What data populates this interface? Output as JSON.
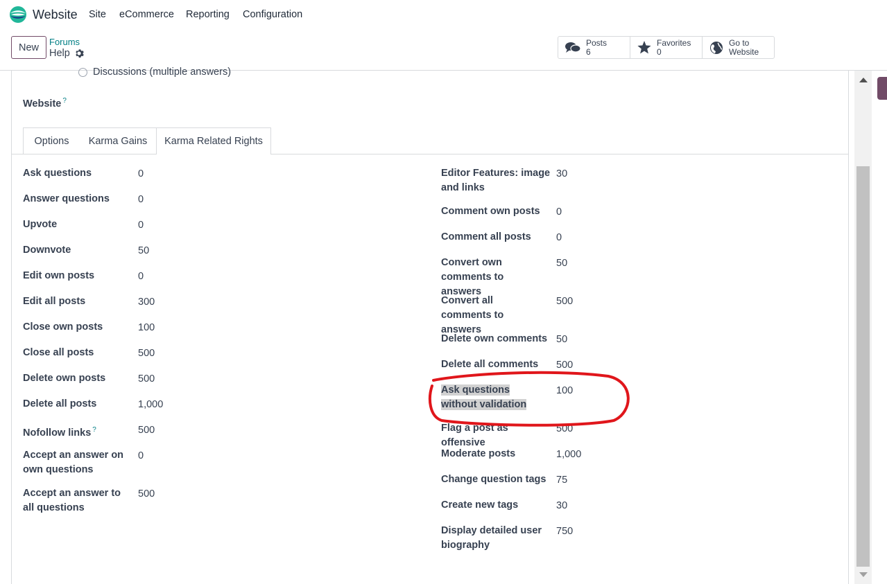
{
  "app": {
    "title": "Website",
    "menu": [
      "Site",
      "eCommerce",
      "Reporting",
      "Configuration"
    ]
  },
  "control": {
    "new_label": "New",
    "breadcrumb_parent": "Forums",
    "breadcrumb_current": "Help",
    "stats": [
      {
        "label": "Posts",
        "value": "6",
        "icon": "comments-icon"
      },
      {
        "label": "Favorites",
        "value": "0",
        "icon": "star-icon"
      },
      {
        "label": "Go to",
        "value": "Website",
        "icon": "globe-icon"
      }
    ]
  },
  "form": {
    "radio_option": "Discussions (multiple answers)",
    "website_label": "Website",
    "help_mark": "?",
    "tabs": [
      "Options",
      "Karma Gains",
      "Karma Related Rights"
    ],
    "active_tab": "Karma Related Rights",
    "left_rows": [
      {
        "label": "Ask questions",
        "value": "0"
      },
      {
        "label": "Answer questions",
        "value": "0"
      },
      {
        "label": "Upvote",
        "value": "0"
      },
      {
        "label": "Downvote",
        "value": "50"
      },
      {
        "label": "Edit own posts",
        "value": "0"
      },
      {
        "label": "Edit all posts",
        "value": "300"
      },
      {
        "label": "Close own posts",
        "value": "100"
      },
      {
        "label": "Close all posts",
        "value": "500"
      },
      {
        "label": "Delete own posts",
        "value": "500"
      },
      {
        "label": "Delete all posts",
        "value": "1,000"
      },
      {
        "label": "Nofollow links",
        "value": "500"
      },
      {
        "label": "Accept an answer on own questions",
        "value": "0"
      },
      {
        "label": "Accept an answer to all questions",
        "value": "500"
      }
    ],
    "right_rows": [
      {
        "label": "Editor Features: image and links",
        "value": "30"
      },
      {
        "label": "Comment own posts",
        "value": "0"
      },
      {
        "label": "Comment all posts",
        "value": "0"
      },
      {
        "label": "Convert own comments to answers",
        "value": "50"
      },
      {
        "label": "Convert all comments to answers",
        "value": "500"
      },
      {
        "label": "Delete own comments",
        "value": "50"
      },
      {
        "label": "Delete all comments",
        "value": "500"
      },
      {
        "label": "Ask questions without validation",
        "value": "100"
      },
      {
        "label": "Flag a post as offensive",
        "value": "500"
      },
      {
        "label": "Moderate posts",
        "value": "1,000"
      },
      {
        "label": "Change question tags",
        "value": "75"
      },
      {
        "label": "Create new tags",
        "value": "30"
      },
      {
        "label": "Display detailed user biography",
        "value": "750"
      }
    ]
  },
  "colors": {
    "brand": "#714b67",
    "link": "#017e84",
    "annotation": "#e0161b"
  }
}
